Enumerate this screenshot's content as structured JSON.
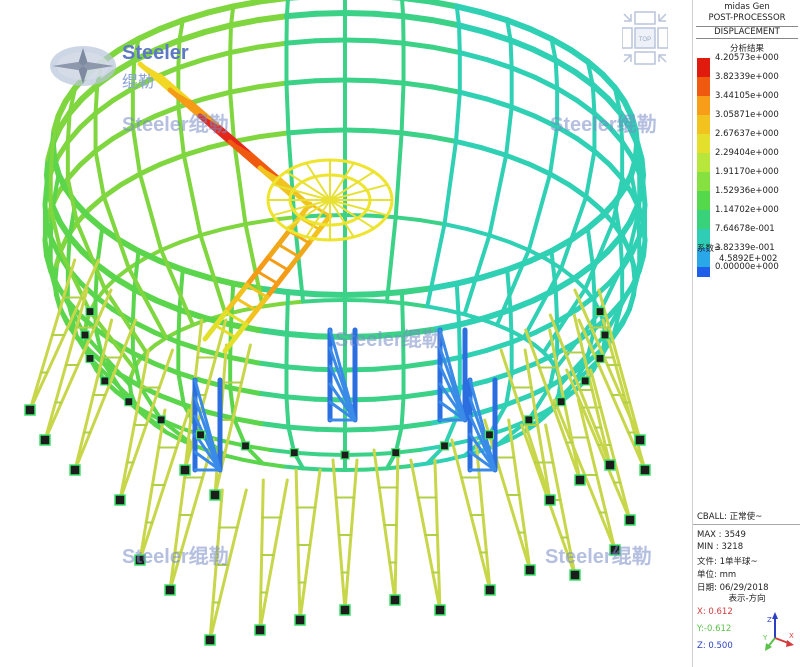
{
  "watermarks": {
    "logo": "Steeler",
    "logo_sub": "绲勒",
    "mark": "Steeler绲勒"
  },
  "viewcube": {
    "label": "TOP"
  },
  "panel": {
    "program": "midas Gen",
    "processor": "POST-PROCESSOR",
    "result_type": "DISPLACEMENT",
    "result_sub": "分析结果",
    "legend": {
      "values": [
        "4.20573e+000",
        "3.82339e+000",
        "3.44105e+000",
        "3.05871e+000",
        "2.67637e+000",
        "2.29404e+000",
        "1.91170e+000",
        "1.52936e+000",
        "1.14702e+000",
        "7.64678e-001",
        "3.82339e-001",
        "0.00000e+000"
      ],
      "colors": [
        "#e01b0e",
        "#f05a10",
        "#f89d18",
        "#f2c21f",
        "#e3df2a",
        "#b8e63a",
        "#86e040",
        "#55d84c",
        "#38d27a",
        "#2fcdb6",
        "#29a7e6",
        "#1d5fe8"
      ]
    },
    "factor_label": "系数=",
    "factor_value": "4.5892E+002",
    "cball": "CBALL: 正常使~",
    "max": "MAX : 3549",
    "min": "MIN : 3218",
    "file": "文件: 1单半球~",
    "unit": "单位: mm",
    "date": "日期: 06/29/2018",
    "direction": "表示-方向",
    "x": "X: 0.612",
    "y": "Y:-0.612",
    "z": "Z: 0.500"
  }
}
